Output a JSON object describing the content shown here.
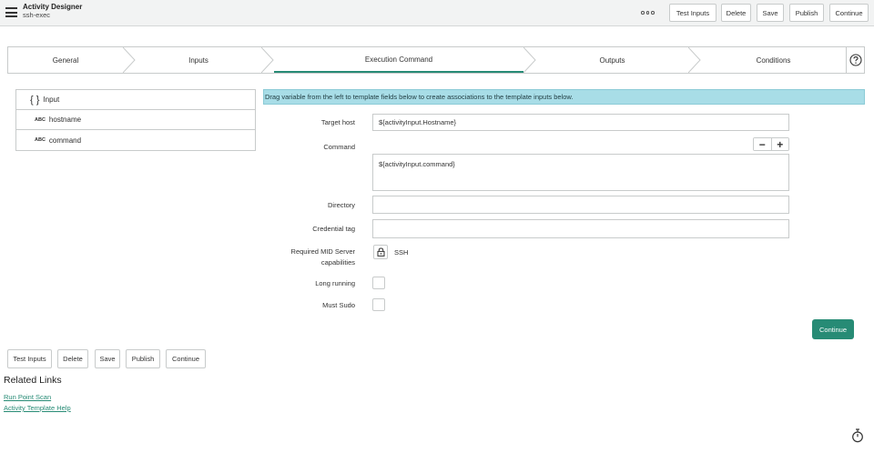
{
  "header": {
    "title": "Activity Designer",
    "subtitle": "ssh-exec",
    "menu_icon": "hamburger-menu-icon",
    "more_icon": "more-options-icon",
    "buttons": {
      "test_inputs": "Test Inputs",
      "delete": "Delete",
      "save": "Save",
      "publish": "Publish",
      "continue": "Continue"
    }
  },
  "steps": {
    "general": "General",
    "inputs": "Inputs",
    "execution_command": "Execution Command",
    "outputs": "Outputs",
    "conditions": "Conditions",
    "active": "Execution Command",
    "help_icon": "help-circle-icon"
  },
  "variables": {
    "root": "Input",
    "type_badge": "ABC",
    "items": [
      "hostname",
      "command"
    ]
  },
  "info_banner": "Drag variable from the left to template fields below to create associations to the template inputs below.",
  "form": {
    "target_host": {
      "label": "Target host",
      "value": "${activityInput.Hostname}"
    },
    "command": {
      "label": "Command",
      "value": "${activityInput.command}"
    },
    "directory": {
      "label": "Directory",
      "value": ""
    },
    "credential_tag": {
      "label": "Credential tag",
      "value": ""
    },
    "mid_server": {
      "label_line1": "Required MID Server",
      "label_line2": "capabilities",
      "value": "SSH",
      "icon": "lock-icon"
    },
    "long_running": {
      "label": "Long running",
      "checked": false
    },
    "must_sudo": {
      "label": "Must Sudo",
      "checked": false
    },
    "minus": "−",
    "plus": "+",
    "continue": "Continue"
  },
  "bottom_buttons": {
    "test_inputs": "Test Inputs",
    "delete": "Delete",
    "save": "Save",
    "publish": "Publish",
    "continue": "Continue"
  },
  "related_links": {
    "title": "Related Links",
    "links": [
      "Run Point Scan",
      "Activity Template Help"
    ]
  },
  "footer_icon": "timer-icon",
  "colors": {
    "accent": "#278b75",
    "info_banner": "#a8dde7",
    "header_bg": "#f2f3f3"
  }
}
